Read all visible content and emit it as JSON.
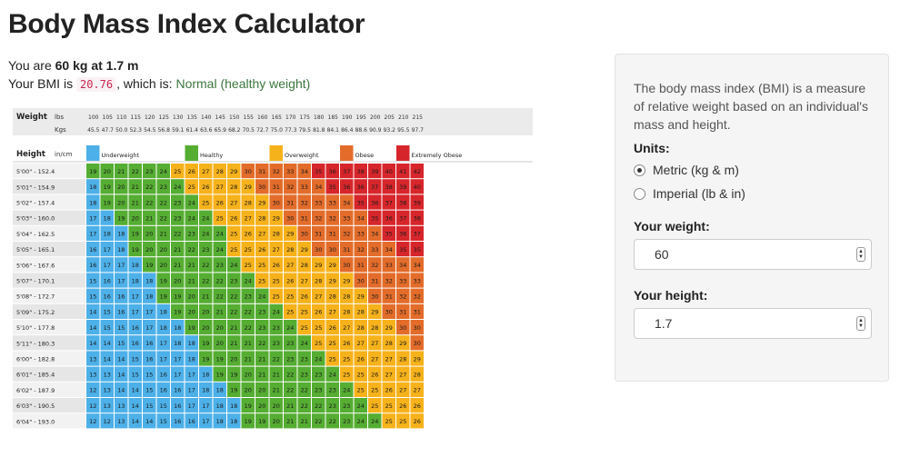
{
  "title": "Body Mass Index Calculator",
  "summary": {
    "you_are_prefix": "You are",
    "you_are_value": "60 kg at 1.7 m",
    "bmi_prefix": "Your BMI is",
    "bmi_value": "20.76",
    "bmi_mid": ", which is:",
    "category": "Normal (healthy weight)"
  },
  "colors": {
    "underweight": "#4db0e8",
    "healthy": "#55ad32",
    "overweight": "#f6b21b",
    "obese": "#e36c2a",
    "extremely_obese": "#d7262b"
  },
  "chart_data": {
    "type": "heatmap",
    "weight_label": "Weight",
    "lbs_label": "lbs",
    "kgs_label": "Kgs",
    "height_label": "Height",
    "height_unit": "in/cm",
    "lbs": [
      "100",
      "105",
      "110",
      "115",
      "120",
      "125",
      "130",
      "135",
      "140",
      "145",
      "150",
      "155",
      "160",
      "165",
      "170",
      "175",
      "180",
      "185",
      "190",
      "195",
      "200",
      "205",
      "210",
      "215"
    ],
    "kgs": [
      "45.5",
      "47.7",
      "50.0",
      "52.3",
      "54.5",
      "56.8",
      "59.1",
      "61.4",
      "63.6",
      "65.9",
      "68.2",
      "70.5",
      "72.7",
      "75.0",
      "77.3",
      "79.5",
      "81.8",
      "84.1",
      "86.4",
      "88.6",
      "90.9",
      "93.2",
      "95.5",
      "97.7"
    ],
    "legend": [
      {
        "label": "Underweight",
        "key": "underweight"
      },
      {
        "label": "Healthy",
        "key": "healthy"
      },
      {
        "label": "Overweight",
        "key": "overweight"
      },
      {
        "label": "Obese",
        "key": "obese"
      },
      {
        "label": "Extremely Obese",
        "key": "extremely_obese"
      }
    ],
    "heights": [
      "5'00\" - 152.4",
      "5'01\" - 154.9",
      "5'02\" - 157.4",
      "5'03\" - 160.0",
      "5'04\" - 162.5",
      "5'05\" - 165.1",
      "5'06\" - 167.6",
      "5'07\" - 170.1",
      "5'08\" - 172.7",
      "5'09\" - 175.2",
      "5'10\" - 177.8",
      "5'11\" - 180.3",
      "6'00\" - 182.8",
      "6'01\" - 185.4",
      "6'02\" - 187.9",
      "6'03\" - 190.5",
      "6'04\" - 193.0"
    ],
    "values": [
      [
        19,
        20,
        21,
        22,
        23,
        24,
        25,
        26,
        27,
        28,
        29,
        30,
        31,
        32,
        33,
        34,
        35,
        36,
        37,
        38,
        39,
        40,
        41,
        42
      ],
      [
        18,
        19,
        20,
        21,
        22,
        23,
        24,
        25,
        26,
        27,
        28,
        29,
        30,
        31,
        32,
        33,
        34,
        35,
        36,
        36,
        37,
        38,
        39,
        40
      ],
      [
        18,
        19,
        20,
        21,
        22,
        22,
        23,
        24,
        25,
        26,
        27,
        28,
        29,
        30,
        31,
        32,
        33,
        33,
        34,
        35,
        36,
        37,
        38,
        39
      ],
      [
        17,
        18,
        19,
        20,
        21,
        22,
        23,
        24,
        24,
        25,
        26,
        27,
        28,
        29,
        30,
        31,
        32,
        32,
        33,
        34,
        35,
        36,
        37,
        38
      ],
      [
        17,
        18,
        18,
        19,
        20,
        21,
        22,
        23,
        24,
        24,
        25,
        26,
        27,
        28,
        29,
        30,
        31,
        31,
        32,
        33,
        34,
        35,
        36,
        37
      ],
      [
        16,
        17,
        18,
        19,
        20,
        20,
        21,
        22,
        23,
        24,
        25,
        25,
        26,
        27,
        28,
        29,
        30,
        30,
        31,
        32,
        33,
        34,
        35,
        35
      ],
      [
        16,
        17,
        17,
        18,
        19,
        20,
        21,
        21,
        22,
        23,
        24,
        25,
        25,
        26,
        27,
        28,
        29,
        29,
        30,
        31,
        32,
        33,
        34,
        34
      ],
      [
        15,
        16,
        17,
        18,
        18,
        19,
        20,
        21,
        22,
        22,
        23,
        24,
        25,
        25,
        26,
        27,
        28,
        29,
        29,
        30,
        31,
        32,
        33,
        33
      ],
      [
        15,
        16,
        16,
        17,
        18,
        19,
        19,
        20,
        21,
        22,
        22,
        23,
        24,
        25,
        25,
        26,
        27,
        28,
        28,
        29,
        30,
        31,
        32,
        32
      ],
      [
        14,
        15,
        16,
        17,
        17,
        18,
        19,
        20,
        20,
        21,
        22,
        22,
        23,
        24,
        25,
        25,
        26,
        27,
        28,
        28,
        29,
        30,
        31,
        31
      ],
      [
        14,
        15,
        15,
        16,
        17,
        18,
        18,
        19,
        20,
        20,
        21,
        22,
        23,
        23,
        24,
        25,
        25,
        26,
        27,
        28,
        28,
        29,
        30,
        30
      ],
      [
        14,
        14,
        15,
        16,
        16,
        17,
        18,
        18,
        19,
        20,
        21,
        21,
        22,
        23,
        23,
        24,
        25,
        25,
        26,
        27,
        27,
        28,
        29,
        30
      ],
      [
        13,
        14,
        14,
        15,
        16,
        17,
        17,
        18,
        19,
        19,
        20,
        21,
        21,
        22,
        23,
        23,
        24,
        25,
        25,
        26,
        27,
        27,
        28,
        29
      ],
      [
        13,
        13,
        14,
        15,
        15,
        16,
        17,
        17,
        18,
        19,
        19,
        20,
        21,
        21,
        22,
        23,
        23,
        24,
        25,
        25,
        26,
        27,
        27,
        28
      ],
      [
        12,
        13,
        14,
        14,
        15,
        16,
        16,
        17,
        18,
        18,
        19,
        20,
        20,
        21,
        22,
        22,
        23,
        23,
        24,
        25,
        25,
        26,
        27,
        27
      ],
      [
        12,
        13,
        13,
        14,
        15,
        15,
        16,
        17,
        17,
        18,
        18,
        19,
        20,
        20,
        21,
        22,
        22,
        23,
        23,
        24,
        25,
        25,
        26,
        26
      ],
      [
        12,
        12,
        13,
        14,
        14,
        15,
        16,
        16,
        17,
        18,
        18,
        19,
        19,
        20,
        21,
        21,
        22,
        22,
        23,
        24,
        24,
        25,
        25,
        26
      ]
    ]
  },
  "panel": {
    "help_text": "The body mass index (BMI) is a measure of relative weight based on an individual's mass and height.",
    "units_label": "Units:",
    "unit_options": [
      "Metric (kg & m)",
      "Imperial (lb & in)"
    ],
    "selected_unit": "Metric (kg & m)",
    "weight_label": "Your weight:",
    "weight_value": "60",
    "height_label": "Your height:",
    "height_value": "1.7"
  }
}
